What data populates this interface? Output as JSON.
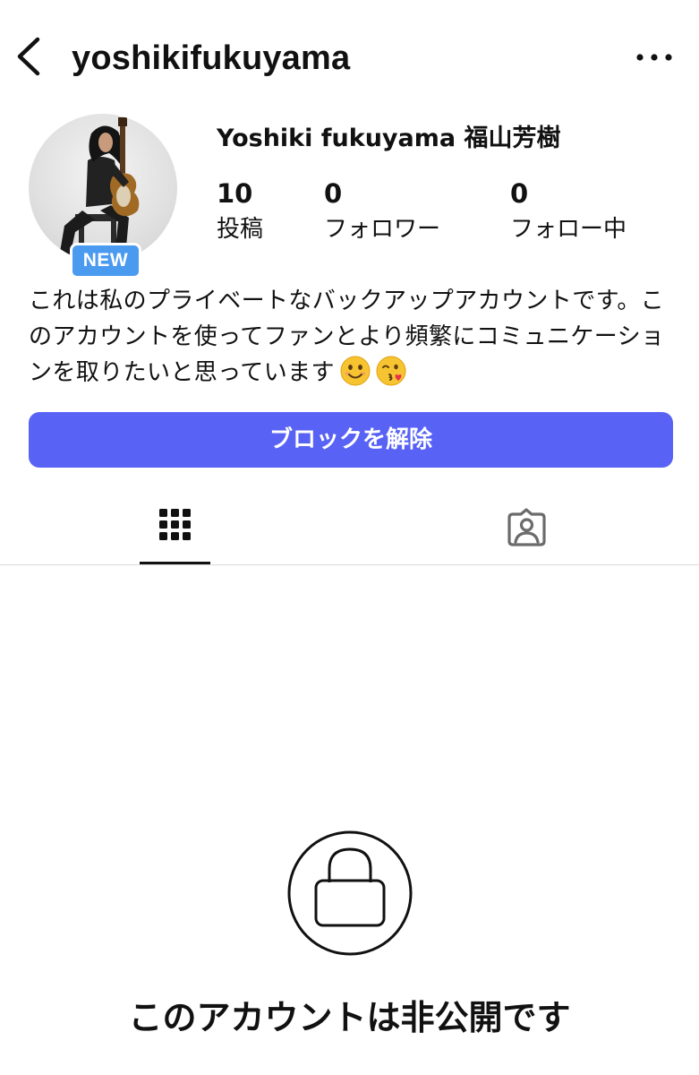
{
  "header": {
    "username": "yoshikifukuyama",
    "back_icon": "chevron-left-icon",
    "more_icon": "more-horizontal-icon"
  },
  "profile": {
    "display_name": "Yoshiki fukuyama 福山芳樹",
    "badge": "NEW",
    "stats": {
      "posts": {
        "count": "10",
        "label": "投稿"
      },
      "followers": {
        "count": "0",
        "label": "フォロワー"
      },
      "following": {
        "count": "0",
        "label": "フォロー中"
      }
    },
    "bio": "これは私のプライベートなバックアップアカウントです。このアカウントを使ってファンとより頻繁にコミュニケーションを取りたいと思っています",
    "bio_emojis": [
      "smiling-face-emoji",
      "face-blowing-kiss-emoji"
    ]
  },
  "actions": {
    "unblock_label": "ブロックを解除"
  },
  "tabs": [
    {
      "name": "grid",
      "icon": "grid-icon",
      "active": true
    },
    {
      "name": "tagged",
      "icon": "tagged-person-icon",
      "active": false
    }
  ],
  "private_notice": {
    "icon": "lock-icon",
    "text": "このアカウントは非公開です"
  },
  "colors": {
    "button": "#5862f5",
    "badge": "#4a9af0",
    "text": "#111111",
    "divider": "#dbdbdb"
  }
}
